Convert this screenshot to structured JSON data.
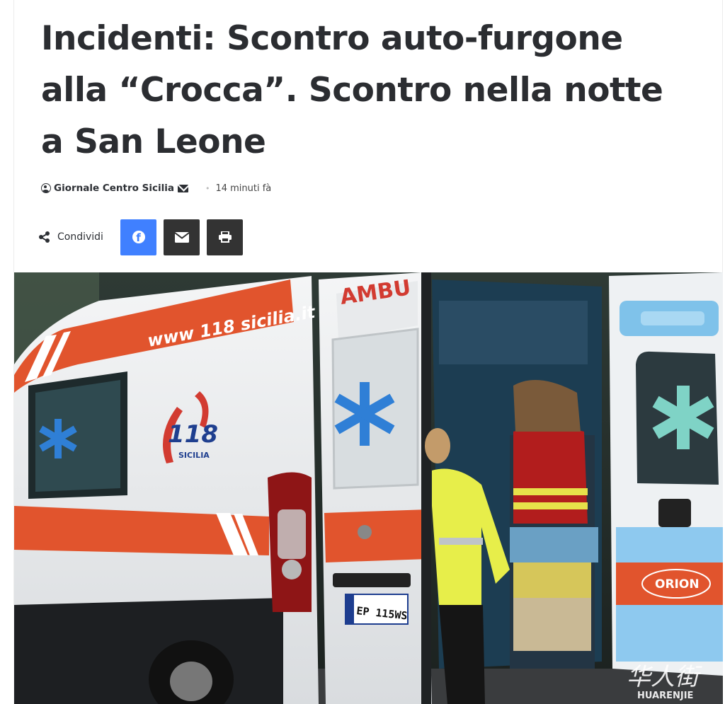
{
  "article": {
    "title": "Incidenti: Scontro auto-furgone alla “Crocca”. Scontro nella notte a San Leone",
    "author": "Giornale Centro Sicilia",
    "time": "14 minuti fà"
  },
  "share": {
    "label": "Condividi",
    "buttons": [
      {
        "name": "facebook",
        "icon": "facebook-icon",
        "color": "#4080ff"
      },
      {
        "name": "email",
        "icon": "envelope-icon",
        "color": "#333333"
      },
      {
        "name": "print",
        "icon": "print-icon",
        "color": "#333333"
      }
    ]
  },
  "hero_image": {
    "texts": {
      "website": "www 118 sicilia.it",
      "logo_number": "118",
      "logo_region": "SICILIA",
      "ambulance": "AMBU",
      "plate": "EP 115WS",
      "brand": "ORION",
      "watermark_cn": "华人街",
      "watermark": "HUARENJIE"
    }
  }
}
